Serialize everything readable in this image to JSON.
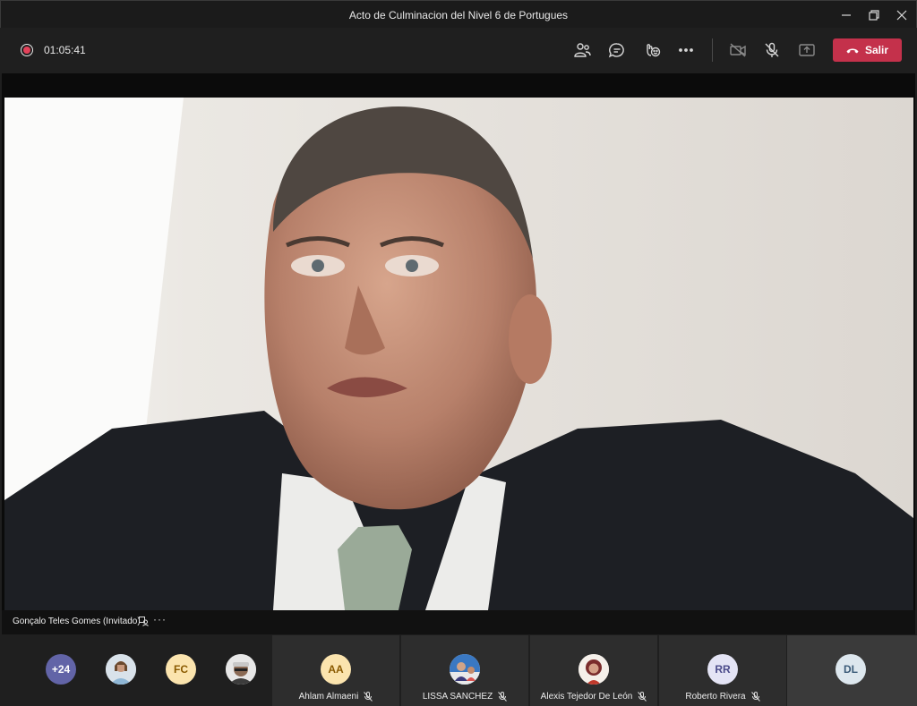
{
  "window": {
    "title": "Acto de Culminacion del Nivel 6 de Portugues"
  },
  "toolbar": {
    "timer": "01:05:41",
    "leave_label": "Salir",
    "icons": [
      "participants-icon",
      "chat-icon",
      "reactions-icon",
      "more-icon",
      "camera-off-icon",
      "mic-off-icon",
      "share-icon"
    ]
  },
  "main_video": {
    "speaker_name": "Gonçalo Teles Gomes (Invitado)",
    "more_label": "···"
  },
  "participants": {
    "overflow_count": "+24",
    "small": [
      {
        "kind": "photo",
        "initials": ""
      },
      {
        "kind": "initials",
        "initials": "FC"
      },
      {
        "kind": "photo",
        "initials": ""
      }
    ],
    "tiles": [
      {
        "name": "Ahlam Almaeni",
        "initials": "AA",
        "muted": true
      },
      {
        "name": "LISSA SANCHEZ",
        "initials": "",
        "muted": true
      },
      {
        "name": "Alexis Tejedor De León",
        "initials": "",
        "muted": true
      },
      {
        "name": "Roberto Rivera",
        "initials": "RR",
        "muted": true
      },
      {
        "name": "",
        "initials": "DL",
        "muted": false
      }
    ]
  },
  "colors": {
    "leave": "#c4314b",
    "record": "#e3425a",
    "overflow": "#6264a7"
  }
}
